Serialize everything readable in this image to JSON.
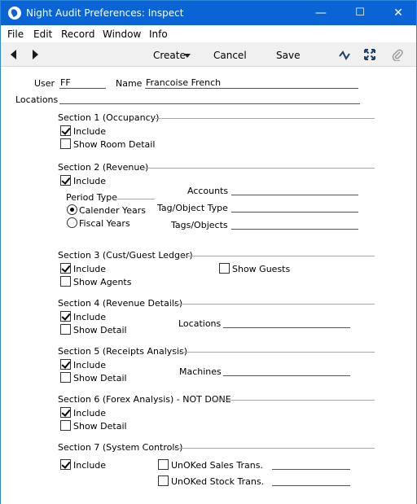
{
  "window": {
    "title": "Night Audit Preferences: Inspect",
    "controls": {
      "minimize": "—",
      "maximize": "☐",
      "close": "✕"
    }
  },
  "menu": [
    "File",
    "Edit",
    "Record",
    "Window",
    "Info"
  ],
  "toolbar": {
    "create_label": "Create",
    "cancel_label": "Cancel",
    "save_label": "Save"
  },
  "header": {
    "user_label": "User",
    "user_value": "FF",
    "name_label": "Name",
    "name_value": "Francoise French",
    "locations_label": "Locations",
    "locations_value": ""
  },
  "section1": {
    "title": "Section 1 (Occupancy)",
    "include_label": "Include",
    "include_checked": true,
    "room_detail_label": "Show Room Detail",
    "room_detail_checked": false
  },
  "section2": {
    "title": "Section 2 (Revenue)",
    "include_label": "Include",
    "include_checked": true,
    "period_type_label": "Period Type",
    "calendar_label": "Calender Years",
    "fiscal_label": "Fiscal Years",
    "selected_period": "calendar",
    "accounts_label": "Accounts",
    "tag_type_label": "Tag/Object Type",
    "tags_label": "Tags/Objects"
  },
  "section3": {
    "title": "Section 3 (Cust/Guest Ledger)",
    "include_label": "Include",
    "include_checked": true,
    "show_agents_label": "Show Agents",
    "show_agents_checked": false,
    "show_guests_label": "Show Guests",
    "show_guests_checked": false
  },
  "section4": {
    "title": "Section 4 (Revenue Details)",
    "include_label": "Include",
    "include_checked": true,
    "show_detail_label": "Show Detail",
    "show_detail_checked": false,
    "locations_label": "Locations"
  },
  "section5": {
    "title": "Section 5 (Receipts Analysis)",
    "include_label": "Include",
    "include_checked": true,
    "show_detail_label": "Show Detail",
    "show_detail_checked": false,
    "machines_label": "Machines"
  },
  "section6": {
    "title": "Section 6 (Forex Analysis) - NOT DONE",
    "include_label": "Include",
    "include_checked": true,
    "show_detail_label": "Show Detail",
    "show_detail_checked": false
  },
  "section7": {
    "title": "Section 7 (System Controls)",
    "include_label": "Include",
    "include_checked": true,
    "unoked_sales_label": "UnOKed Sales Trans.",
    "unoked_sales_checked": false,
    "unoked_stock_label": "UnOKed Stock Trans.",
    "unoked_stock_checked": false
  }
}
